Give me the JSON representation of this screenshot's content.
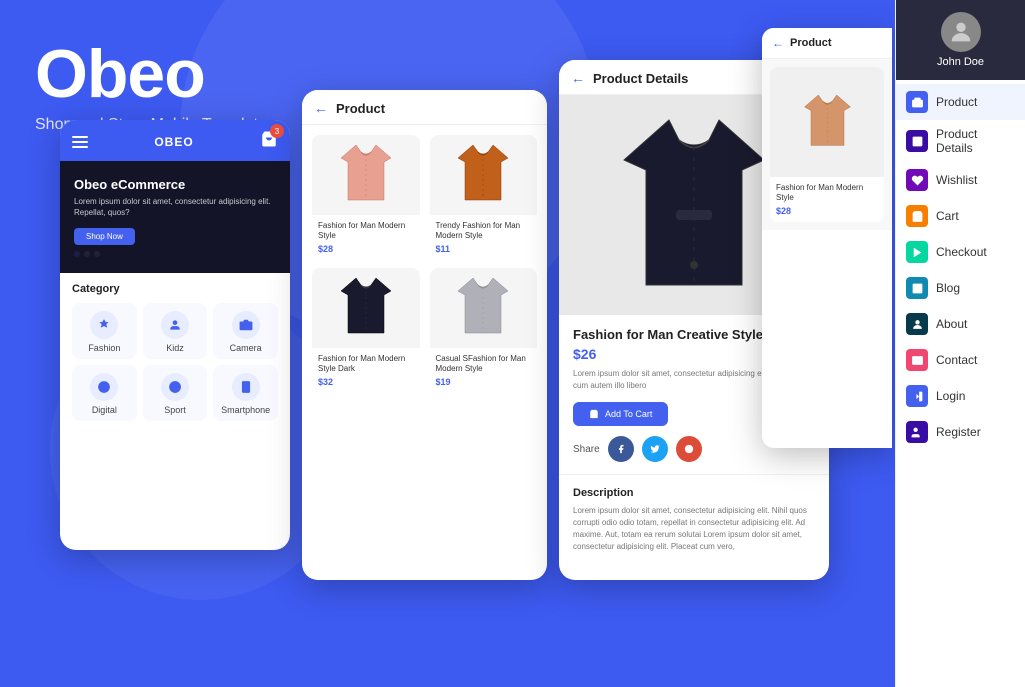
{
  "brand": {
    "name": "Obeo",
    "tagline": "Shop and Store Mobile Template"
  },
  "sidebar": {
    "profile": {
      "name": "John Doe"
    },
    "items": [
      {
        "id": "product",
        "label": "Product",
        "iconColor": "blue"
      },
      {
        "id": "product-details",
        "label": "Product Details",
        "iconColor": "indigo"
      },
      {
        "id": "wishlist",
        "label": "Wishlist",
        "iconColor": "purple"
      },
      {
        "id": "cart",
        "label": "Cart",
        "iconColor": "cart-c"
      },
      {
        "id": "checkout",
        "label": "Checkout",
        "iconColor": "green"
      },
      {
        "id": "blog",
        "label": "Blog",
        "iconColor": "blog-c"
      },
      {
        "id": "about",
        "label": "About",
        "iconColor": "about-c"
      },
      {
        "id": "contact",
        "label": "Contact",
        "iconColor": "contact-c"
      },
      {
        "id": "login",
        "label": "Login",
        "iconColor": "login-c"
      },
      {
        "id": "register",
        "label": "Register",
        "iconColor": "register-c"
      }
    ]
  },
  "phone1": {
    "logo": "OBEO",
    "cartCount": "3",
    "banner": {
      "title": "Obeo eCommerce",
      "desc": "Lorem ipsum dolor sit amet, consectetur adipisicing elit. Repellat, quos?",
      "button": "Shop Now"
    },
    "category": {
      "title": "Category",
      "items": [
        {
          "label": "Fashion",
          "icon": "fashion"
        },
        {
          "label": "Kidz",
          "icon": "kidz"
        },
        {
          "label": "Camera",
          "icon": "camera"
        },
        {
          "label": "Digital",
          "icon": "digital"
        },
        {
          "label": "Sport",
          "icon": "sport"
        },
        {
          "label": "Smartphone",
          "icon": "smartphone"
        }
      ]
    }
  },
  "phone2": {
    "header": {
      "back": "←",
      "title": "Product"
    },
    "products": [
      {
        "name": "Fashion for Man Modern Style",
        "price": "$28",
        "color": "pink"
      },
      {
        "name": "Trendy Fashion for Man Modern Style",
        "price": "$11",
        "color": "orange"
      },
      {
        "name": "Fashion for Man Modern Style Dark",
        "price": "$32",
        "color": "dark"
      },
      {
        "name": "Casual SFashion for Man Modern Style",
        "price": "$19",
        "color": "gray"
      }
    ]
  },
  "phone3": {
    "header": {
      "back": "←",
      "title": "Product Details"
    },
    "product": {
      "title": "Fashion for Man Creative Style",
      "price": "$26",
      "desc": "Lorem ipsum dolor sit amet, consectetur adipisicing elit. Possimus cum autem illo libero",
      "addToCart": "Add To Cart",
      "share": "Share"
    },
    "description": {
      "title": "Description",
      "text": "Lorem ipsum dolor sit amet, consectetur adipisicing elit. Nihil quos corrupti odio odio totam, repellat in consectetur adipisicing elit. Ad maxime. Aut, totam ea rerum solutai Lorem ipsum dolor sit amet, consectetur adipisicing elit. Placeat cum vero,"
    }
  },
  "phone4": {
    "header": {
      "back": "←",
      "title": "Product"
    },
    "product": {
      "name": "Fashion for Man Modern Style",
      "price": "$28",
      "color": "peach"
    }
  }
}
